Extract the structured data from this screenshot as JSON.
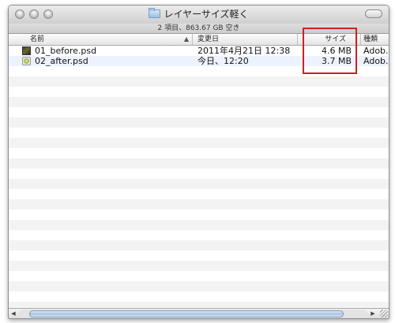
{
  "window": {
    "title": "レイヤーサイズ軽く",
    "status": "2 項目、863.67 GB 空き"
  },
  "columns": {
    "name": "名前",
    "date": "変更日",
    "size": "サイズ",
    "kind": "種類"
  },
  "files": [
    {
      "name": "01_before.psd",
      "date": "2011年4月21日 12:38",
      "size": "4.6 MB",
      "kind": "Adob.",
      "icon": "psd-file-icon"
    },
    {
      "name": "02_after.psd",
      "date": "今日、12:20",
      "size": "3.7 MB",
      "kind": "Adob.",
      "icon": "psd-file-icon"
    }
  ],
  "colors": {
    "highlight_box": "#d11f1f",
    "row_stripe": "#f3f3f3",
    "row_alt": "#edf3fe"
  }
}
